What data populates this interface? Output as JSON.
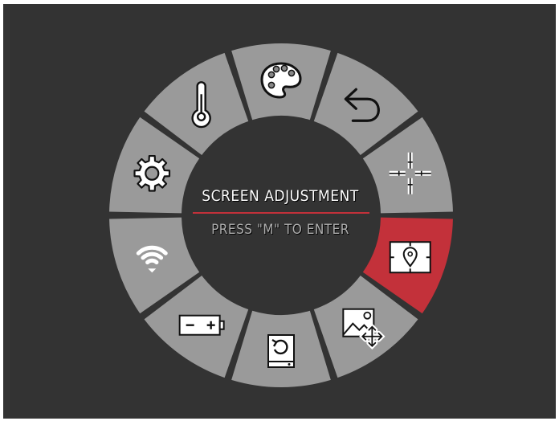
{
  "menu": {
    "title": "SCREEN ADJUSTMENT",
    "hint": "PRESS \"M\" TO ENTER",
    "selected": "screen-adjustment",
    "colors": {
      "background": "#333333",
      "segment": "#9a9a9a",
      "selected": "#c3313a",
      "icon": "#111111"
    },
    "items": [
      {
        "id": "palette",
        "icon": "palette-icon"
      },
      {
        "id": "back",
        "icon": "undo-arrow-icon"
      },
      {
        "id": "reticle",
        "icon": "crosshair-icon"
      },
      {
        "id": "screen-adjustment",
        "icon": "screen-position-icon"
      },
      {
        "id": "image",
        "icon": "image-move-icon"
      },
      {
        "id": "storage",
        "icon": "sd-card-restore-icon"
      },
      {
        "id": "battery",
        "icon": "battery-icon"
      },
      {
        "id": "wifi",
        "icon": "wifi-icon"
      },
      {
        "id": "settings",
        "icon": "gear-icon"
      },
      {
        "id": "temperature",
        "icon": "thermometer-icon"
      }
    ]
  }
}
